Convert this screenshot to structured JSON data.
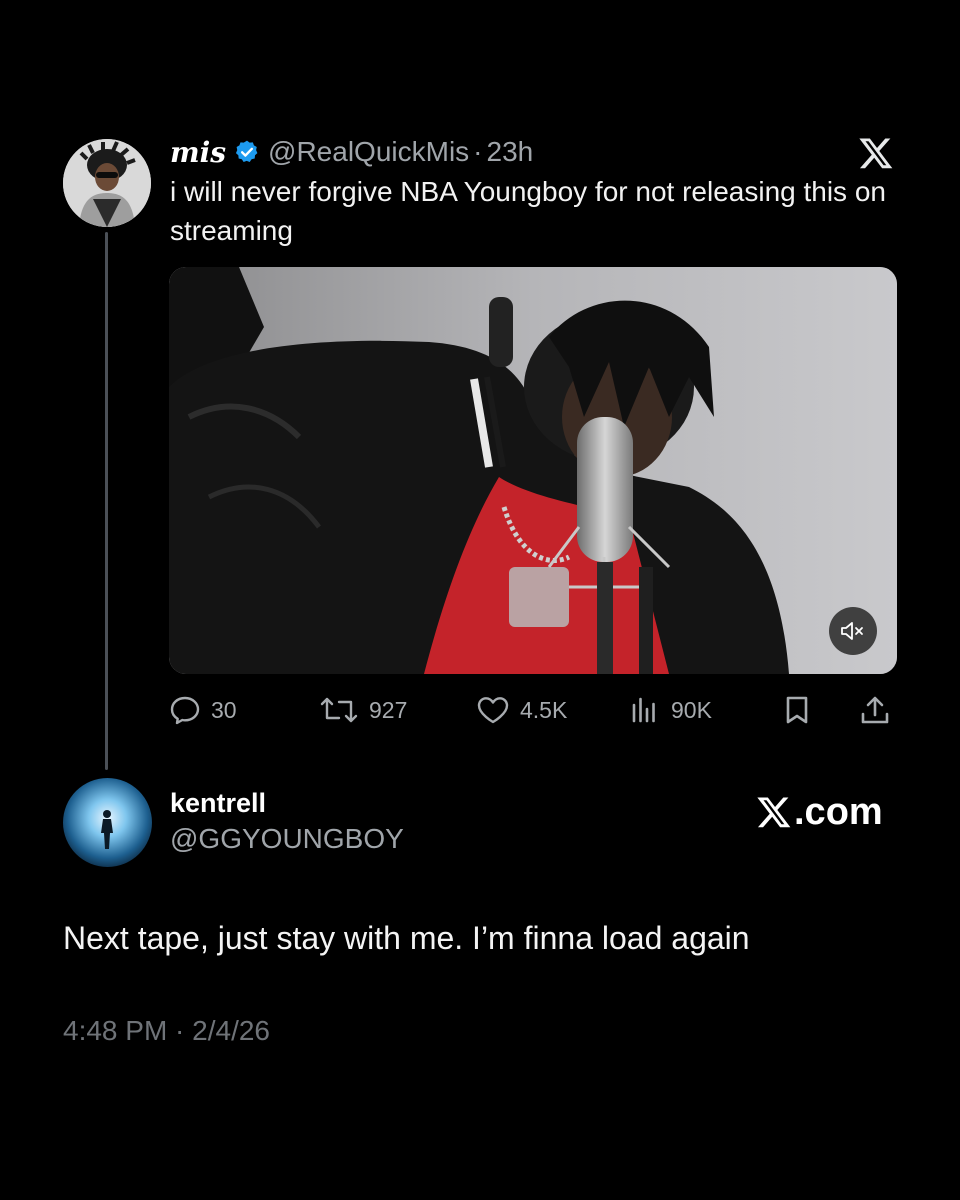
{
  "quoted_tweet": {
    "name": "mis",
    "handle": "@RealQuickMis",
    "separator": "·",
    "time": "23h",
    "text": "i will never forgive NBA Youngboy for not releasing this on streaming",
    "verified": true,
    "media": {
      "type": "video",
      "muted": true
    },
    "actions": {
      "replies": "30",
      "reposts": "927",
      "likes": "4.5K",
      "views": "90K"
    }
  },
  "main_tweet": {
    "name": "kentrell",
    "handle": "@GGYOUNGBOY",
    "text": "Next tape, just stay with me. I’m finna load again",
    "timestamp": "4:48 PM · 2/4/26",
    "brand": ".com"
  },
  "colors": {
    "background": "#000000",
    "verified_badge": "#1d9bf0",
    "secondary_text": "#a0a5aa",
    "thread_line": "#4b5057"
  },
  "icons": [
    "x-logo-icon",
    "verified-icon",
    "reply-icon",
    "repost-icon",
    "like-icon",
    "views-icon",
    "bookmark-icon",
    "share-icon",
    "mute-icon"
  ]
}
